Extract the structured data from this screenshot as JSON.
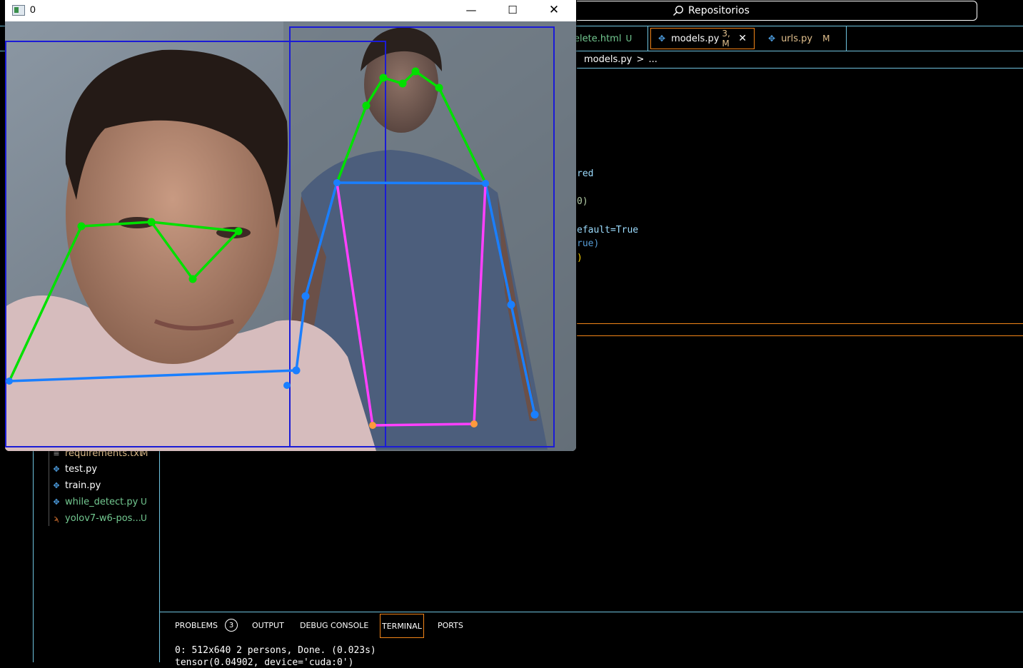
{
  "vscode": {
    "search_label": "Repositorios",
    "tabs": [
      {
        "label": "elete.html",
        "status": "U",
        "status_color": "#73c991"
      },
      {
        "label": "models.py",
        "status": "3, M",
        "status_color": "#e2c08d"
      },
      {
        "label": "urls.py",
        "status": "M",
        "status_color": "#e2c08d"
      }
    ],
    "breadcrumb": {
      "file": "models.py",
      "sep": ">",
      "more": "..."
    },
    "code_fragments": [
      "red",
      "0)",
      "efault=True",
      "rue)",
      ")"
    ],
    "explorer_files": [
      {
        "name": "requirements.txt",
        "status": "M",
        "icon": "list-icon"
      },
      {
        "name": "test.py",
        "status": "",
        "icon": "python-icon"
      },
      {
        "name": "train.py",
        "status": "",
        "icon": "python-icon"
      },
      {
        "name": "while_detect.py",
        "status": "U",
        "icon": "python-icon"
      },
      {
        "name": "yolov7-w6-pos...",
        "status": "U",
        "icon": "rss-icon"
      }
    ],
    "panel_tabs": {
      "problems": "PROBLEMS",
      "problems_count": "3",
      "output": "OUTPUT",
      "debug_console": "DEBUG CONSOLE",
      "terminal": "TERMINAL",
      "ports": "PORTS"
    },
    "terminal_lines": [
      "0: 512x640 2 persons, Done. (0.023s)",
      "tensor(0.04902, device='cuda:0')"
    ]
  },
  "cv_window": {
    "title": "0",
    "minimize": "—",
    "maximize": "☐",
    "close": "✕"
  },
  "colors": {
    "accent_border": "#6fc3df",
    "active_border": "#f38518",
    "face_keypoints": "#00e000",
    "arm_keypoints": "#1a7fff",
    "torso_keypoints": "#ff40ff",
    "bbox": "#1b1bd6"
  }
}
